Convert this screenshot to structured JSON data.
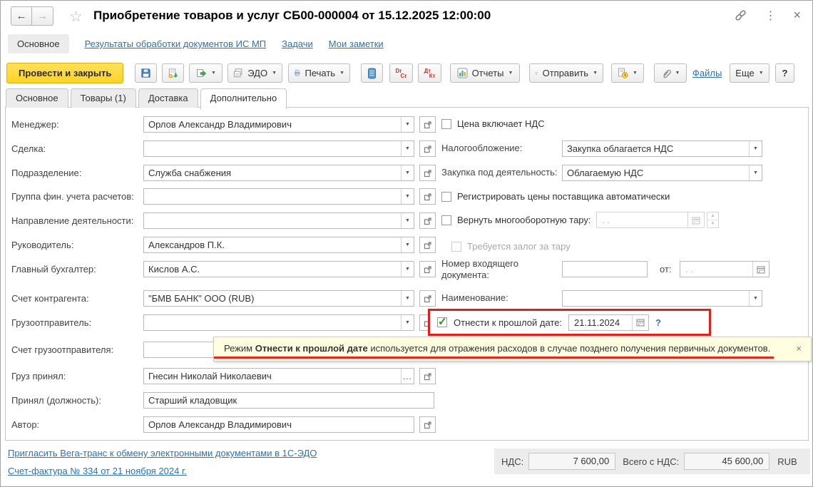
{
  "icons": {
    "back": "←",
    "forward": "→",
    "star": "☆",
    "kebab": "⋮",
    "close": "×",
    "dropdown": "▼",
    "ellipsis": "...",
    "check": "✓",
    "spin_up": "▲",
    "spin_down": "▼",
    "help": "?",
    "tooltip_close": "×"
  },
  "window": {
    "title": "Приобретение товаров и услуг СБ00-000004 от 15.12.2025 12:00:00"
  },
  "nav": {
    "active": "Основное",
    "links": [
      "Результаты обработки документов ИС МП",
      "Задачи",
      "Мои заметки"
    ]
  },
  "toolbar": {
    "primary": "Провести и закрыть",
    "edo": "ЭДО",
    "print": "Печать",
    "drcr_top": "Dr",
    "drcr_bottom": "Cr",
    "dtkt_top": "Дт",
    "dtkt_bottom": "Кт",
    "reports": "Отчеты",
    "send": "Отправить",
    "files": "Файлы",
    "more": "Еще",
    "help": "?"
  },
  "tabs": {
    "items": [
      "Основное",
      "Товары (1)",
      "Доставка",
      "Дополнительно"
    ],
    "active_index": 3
  },
  "left_fields": [
    {
      "label": "Менеджер:",
      "value": "Орлов Александр Владимирович",
      "kind": "combo",
      "open": true
    },
    {
      "label": "Сделка:",
      "value": "",
      "kind": "combo",
      "open": true
    },
    {
      "label": "Подразделение:",
      "value": "Служба снабжения",
      "kind": "combo",
      "open": true
    },
    {
      "label": "Группа фин. учета расчетов:",
      "value": "",
      "kind": "combo",
      "open": true
    },
    {
      "label": "Направление деятельности:",
      "value": "",
      "kind": "combo",
      "open": true
    },
    {
      "label": "Руководитель:",
      "value": "Александров П.К.",
      "kind": "combo",
      "open": true
    },
    {
      "label": "Главный бухгалтер:",
      "value": "Кислов А.С.",
      "kind": "combo",
      "open": true
    },
    {
      "label": "Счет контрагента:",
      "value": "\"БМВ БАНК\" ООО (RUB)",
      "kind": "combo",
      "open": true
    },
    {
      "label": "Грузоотправитель:",
      "value": "",
      "kind": "combo",
      "open": true
    },
    {
      "label": "Счет грузоотправителя:",
      "value": "",
      "kind": "combo",
      "open": false
    },
    {
      "label": "Груз принял:",
      "value": "Гнесин Николай Николаевич",
      "kind": "ellipsis",
      "open": true
    },
    {
      "label": "Принял (должность):",
      "value": "Старший кладовщик",
      "kind": "wide",
      "open": false
    },
    {
      "label": "Автор:",
      "value": "Орлов Александр Владимирович",
      "kind": "plain",
      "open": true
    }
  ],
  "right": {
    "price_includes_vat": "Цена включает НДС",
    "taxation_label": "Налогообложение:",
    "taxation_value": "Закупка облагается НДС",
    "activity_label": "Закупка под деятельность:",
    "activity_value": "Облагаемую НДС",
    "register_prices": "Регистрировать цены поставщика автоматически",
    "return_tare": "Вернуть многооборотную тару:",
    "tare_date_placeholder": ".  .",
    "tare_deposit": "Требуется залог за тару",
    "incoming_number_label": "Номер входящего документа:",
    "incoming_number_value": "",
    "from_label": "от:",
    "incoming_date_placeholder": ".  .",
    "name_label": "Наименование:",
    "name_value": ""
  },
  "highlight": {
    "label": "Отнести к прошлой дате:",
    "date": "21.11.2024",
    "checked": true
  },
  "tooltip": {
    "prefix": "Режим ",
    "bold": "Отнести к прошлой дате",
    "suffix": " используется для отражения расходов в случае позднего получения первичных документов."
  },
  "footer": {
    "links": [
      "Пригласить Вега-транс к обмену электронными документами в 1С-ЭДО",
      "Счет-фактура № 334 от 21 ноября 2024 г."
    ],
    "vat_label": "НДС:",
    "vat_value": "7 600,00",
    "total_label": "Всего с НДС:",
    "total_value": "45 600,00",
    "currency": "RUB"
  }
}
